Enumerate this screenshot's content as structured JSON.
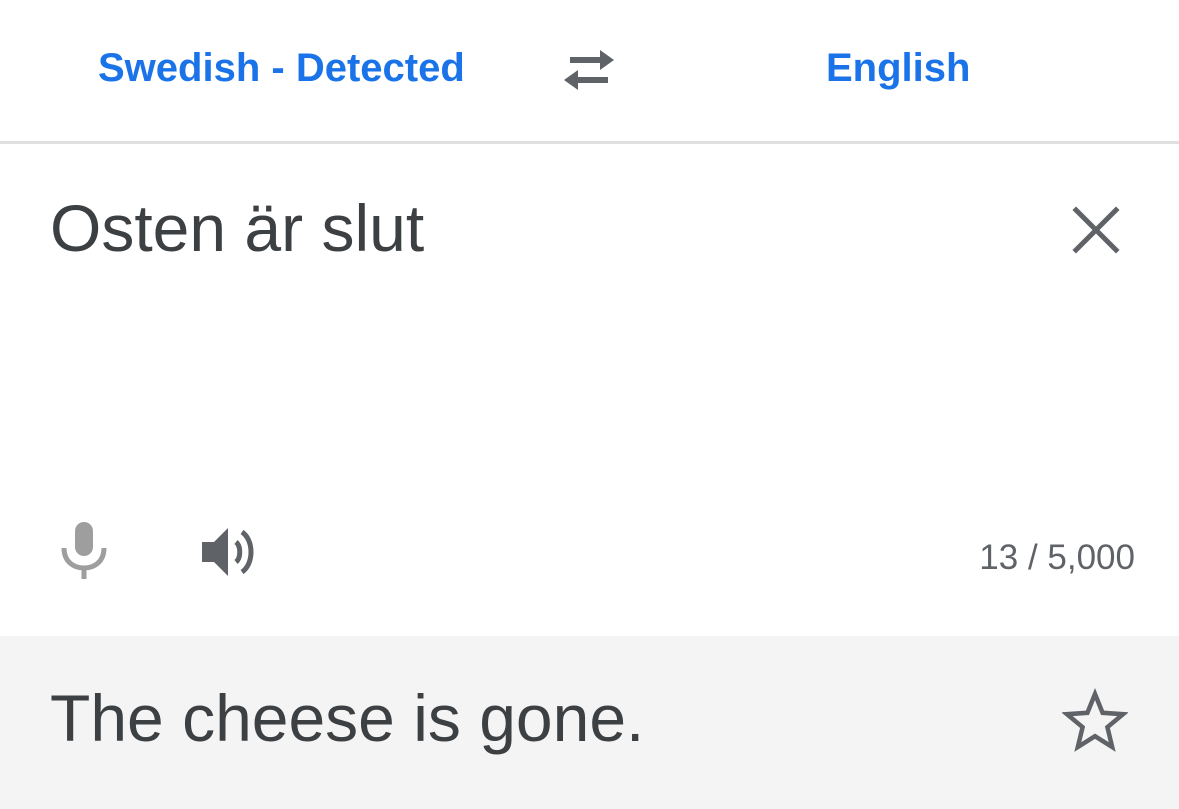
{
  "language_bar": {
    "source_language": "Swedish - Detected",
    "target_language": "English",
    "swap_icon": "swap-horiz-icon"
  },
  "input": {
    "text": "Osten är slut",
    "clear_icon": "close-icon",
    "mic_icon": "mic-icon",
    "mic_enabled": false,
    "speaker_icon": "volume-up-icon",
    "char_count": "13 / 5,000"
  },
  "result": {
    "text": "The cheese is gone.",
    "star_icon": "star-outline-icon"
  },
  "colors": {
    "accent": "#1a73e8",
    "text_primary": "#3c4043",
    "text_secondary": "#5f6368",
    "icon_disabled": "#9e9e9e",
    "result_background": "#f4f4f4",
    "divider": "#e0e0e0"
  }
}
